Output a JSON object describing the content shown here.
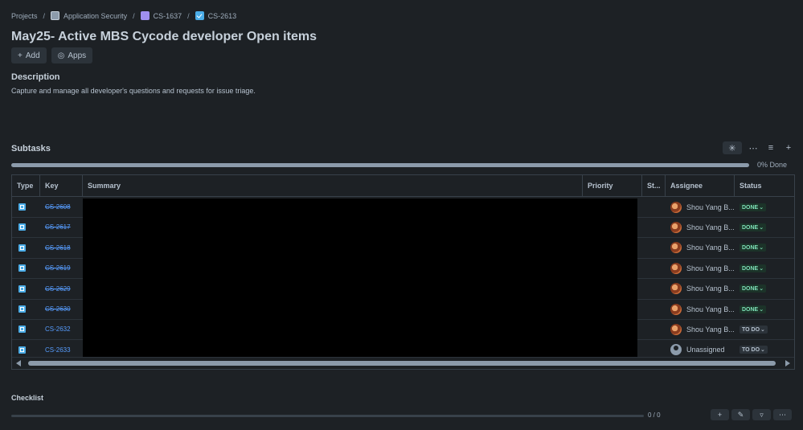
{
  "breadcrumb": {
    "items": [
      "Projects",
      "Application Security",
      "CS-1637",
      "CS-2613"
    ],
    "separator": "/"
  },
  "page": {
    "title": "May25- Active MBS Cycode developer Open items",
    "add_label": "Add",
    "apps_label": "Apps"
  },
  "description": {
    "heading": "Description",
    "text": "Capture and manage all developer's questions and requests for issue triage."
  },
  "subtasks": {
    "heading": "Subtasks",
    "progress_label": "0% Done",
    "progress_fraction": 0,
    "columns": [
      "Type",
      "Key",
      "Summary",
      "Priority",
      "St...",
      "Assignee",
      "Status"
    ],
    "rows": [
      {
        "key": "CS-2608",
        "assignee": "Shou Yang B...",
        "status": "DONE",
        "done": true
      },
      {
        "key": "CS-2617",
        "assignee": "Shou Yang B...",
        "status": "DONE",
        "done": true
      },
      {
        "key": "CS-2618",
        "assignee": "Shou Yang B...",
        "status": "DONE",
        "done": true
      },
      {
        "key": "CS-2619",
        "assignee": "Shou Yang B...",
        "status": "DONE",
        "done": true
      },
      {
        "key": "CS-2629",
        "assignee": "Shou Yang B...",
        "status": "DONE",
        "done": true
      },
      {
        "key": "CS-2630",
        "assignee": "Shou Yang B...",
        "status": "DONE",
        "done": true
      },
      {
        "key": "CS-2632",
        "assignee": "Shou Yang B...",
        "status": "TO DO",
        "done": false
      },
      {
        "key": "CS-2633",
        "assignee": "Unassigned",
        "status": "TO DO",
        "done": false
      }
    ]
  },
  "checklist": {
    "heading": "Checklist",
    "count": "0 / 0"
  },
  "colors": {
    "background": "#1d2125",
    "link": "#579dff",
    "done_badge": "#7ee2b8"
  }
}
